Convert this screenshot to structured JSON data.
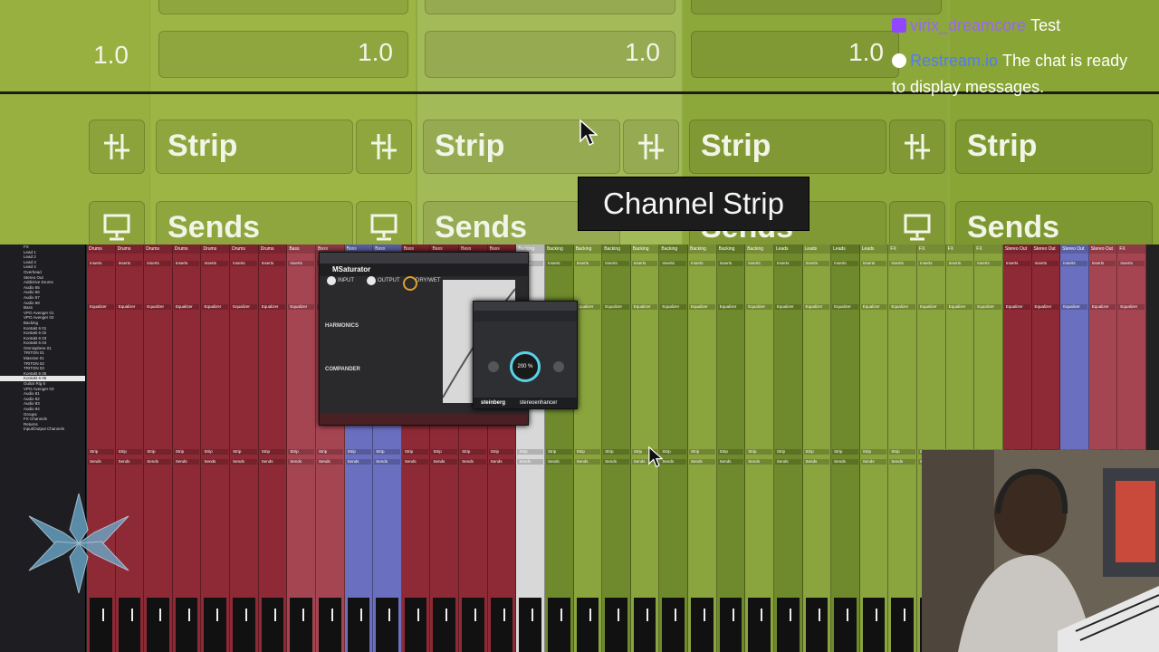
{
  "zoom": {
    "gain_values": [
      "1.0",
      "1.0",
      "1.0",
      "1.0"
    ],
    "strip_label": "Strip",
    "sends_label": "Sends",
    "tooltip": "Channel Strip"
  },
  "chat": {
    "messages": [
      {
        "user": "virix_dreamcore",
        "text": "Test"
      },
      {
        "user": "Restream.io",
        "text": "The chat is ready to display messages."
      }
    ]
  },
  "mixer": {
    "tracks": [
      "FX",
      "Lead 1",
      "Lead 2",
      "Lead 3",
      "Lead 4",
      "Overhead",
      "Stereo Out",
      "Addictive Drums",
      "Audio 65",
      "Audio 66",
      "Audio 67",
      "Audio 68",
      "Bass",
      "VPO Avenger 01",
      "VPO Avenger 02",
      "Backing",
      "Kontakt 6 01",
      "Kontakt 6 02",
      "Kontakt 6 03",
      "Kontakt 6 04",
      "Omnisphere 01",
      "TRITON 01",
      "Massive 01",
      "TRITON 02",
      "TRITON 03",
      "Kontakt 6 05",
      "Kontakt 6 06",
      "Guitar Rig 6",
      "VPO Avenger 03",
      "Audio 81",
      "Audio 82",
      "Audio 83",
      "Audio 84",
      "Groups",
      "FX Channels",
      "Returns",
      "Input/Output Channels"
    ],
    "channel_names": [
      "Drums",
      "Drums",
      "Drums",
      "Drums",
      "Drums",
      "Drums",
      "Drums",
      "Bass",
      "Bass",
      "Bass",
      "Bass",
      "Bass",
      "Bass",
      "Bass",
      "Bass",
      "Backing",
      "Backing",
      "Backing",
      "Backing",
      "Backing",
      "Backing",
      "Backing",
      "Backing",
      "Backing",
      "Leads",
      "Leads",
      "Leads",
      "Leads",
      "FX",
      "FX",
      "FX",
      "FX",
      "Stereo Out",
      "Stereo Out",
      "Stereo Out",
      "Stereo Out",
      "FX"
    ],
    "inserts_label": "Inserts",
    "equalizer_label": "Equalizer",
    "strip_label": "Strip",
    "sends_label": "Sends",
    "colors": {
      "red": "#8e2a35",
      "pink": "#a64552",
      "blue": "#6a6fbf",
      "white": "#d8d8d8",
      "green": "#8aa43e",
      "olive": "#6f8a2c"
    }
  },
  "plugins": {
    "msaturator": {
      "title": "MSaturator",
      "input": "INPUT",
      "output": "OUTPUT",
      "dry_wet": "DRY/WET",
      "harmonics": "HARMONICS",
      "compander": "COMPANDER"
    },
    "stereo": {
      "brand": "steinberg",
      "product": "stereoenhancer",
      "value": "200 %"
    }
  }
}
